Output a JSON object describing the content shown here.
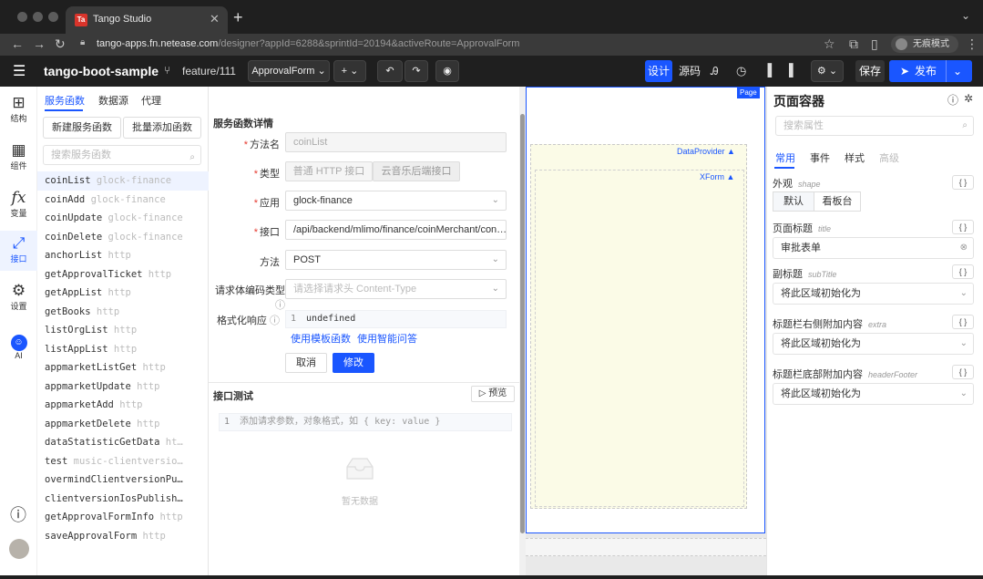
{
  "browser": {
    "tab_title": "Tango Studio",
    "favicon_text": "Ta",
    "url_host": "tango-apps.fn.netease.com",
    "url_path": "/designer?appId=6288&sprintId=20194&activeRoute=ApprovalForm",
    "incognito_label": "无痕模式"
  },
  "header": {
    "app_title": "tango-boot-sample",
    "branch": "feature/111",
    "route_select": "ApprovalForm",
    "design_label": "设计",
    "source_label": "源码",
    "save_label": "保存",
    "publish_label": "发布"
  },
  "rail": {
    "items": [
      {
        "label": "结构"
      },
      {
        "label": "组件"
      },
      {
        "label": "变量"
      },
      {
        "label": "接口"
      },
      {
        "label": "设置"
      },
      {
        "label": "AI"
      }
    ]
  },
  "services": {
    "tabs": [
      "服务函数",
      "数据源",
      "代理"
    ],
    "new_button": "新建服务函数",
    "batch_button": "批量添加函数",
    "search_placeholder": "搜索服务函数",
    "items": [
      {
        "name": "coinList",
        "tag": "glock-finance"
      },
      {
        "name": "coinAdd",
        "tag": "glock-finance"
      },
      {
        "name": "coinUpdate",
        "tag": "glock-finance"
      },
      {
        "name": "coinDelete",
        "tag": "glock-finance"
      },
      {
        "name": "anchorList",
        "tag": "http"
      },
      {
        "name": "getApprovalTicket",
        "tag": "http"
      },
      {
        "name": "getAppList",
        "tag": "http"
      },
      {
        "name": "getBooks",
        "tag": "http"
      },
      {
        "name": "listOrgList",
        "tag": "http"
      },
      {
        "name": "listAppList",
        "tag": "http"
      },
      {
        "name": "appmarketListGet",
        "tag": "http"
      },
      {
        "name": "appmarketUpdate",
        "tag": "http"
      },
      {
        "name": "appmarketAdd",
        "tag": "http"
      },
      {
        "name": "appmarketDelete",
        "tag": "http"
      },
      {
        "name": "dataStatisticGetData",
        "tag": "ht…"
      },
      {
        "name": "test",
        "tag": "music-clientversio…"
      },
      {
        "name": "overmindClientversionPu…",
        "tag": ""
      },
      {
        "name": "clientversionIosPublish…",
        "tag": ""
      },
      {
        "name": "getApprovalFormInfo",
        "tag": "http"
      },
      {
        "name": "saveApprovalForm",
        "tag": "http"
      }
    ]
  },
  "detail": {
    "title": "服务函数详情",
    "method_name_label": "方法名",
    "method_name_value": "coinList",
    "type_label": "类型",
    "type_option_1": "普通 HTTP 接口",
    "type_option_2": "云音乐后端接口",
    "app_label": "应用",
    "app_value": "glock-finance",
    "api_label": "接口",
    "api_value": "/api/backend/mlimo/finance/coinMerchant/con…",
    "method_label": "方法",
    "method_value": "POST",
    "encoding_label": "请求体编码类型",
    "encoding_placeholder": "请选择请求头 Content-Type",
    "format_label": "格式化响应",
    "format_line_no": "1",
    "format_value": "undefined",
    "template_link": "使用模板函数",
    "smart_link": "使用智能问答",
    "cancel_label": "取消",
    "modify_label": "修改",
    "test_title": "接口测试",
    "preview_label": "预览",
    "test_line_no": "1",
    "test_placeholder": "添加请求参数，对象格式，如 { key: value }",
    "empty_text": "暂无数据"
  },
  "canvas": {
    "page_tag": "Page",
    "provider_tag": "DataProvider ▲",
    "xform_tag": "XForm ▲"
  },
  "settings": {
    "title": "页面容器",
    "search_placeholder": "搜索属性",
    "tabs": [
      "常用",
      "事件",
      "样式",
      "高级"
    ],
    "appearance_label": "外观",
    "appearance_key": "shape",
    "appearance_options": [
      "默认",
      "看板台"
    ],
    "page_title_label": "页面标题",
    "page_title_key": "title",
    "page_title_value": "审批表单",
    "subtitle_label": "副标题",
    "subtitle_key": "subTitle",
    "subtitle_value": "将此区域初始化为",
    "extra_label": "标题栏右侧附加内容",
    "extra_key": "extra",
    "extra_value": "将此区域初始化为",
    "footer_label": "标题栏底部附加内容",
    "footer_key": "headerFooter",
    "footer_value": "将此区域初始化为",
    "code_btn": "{ }"
  },
  "colors": {
    "accent": "#1a56ff",
    "required": "#e5392f",
    "canvas_highlight": "#fbfbe7"
  }
}
